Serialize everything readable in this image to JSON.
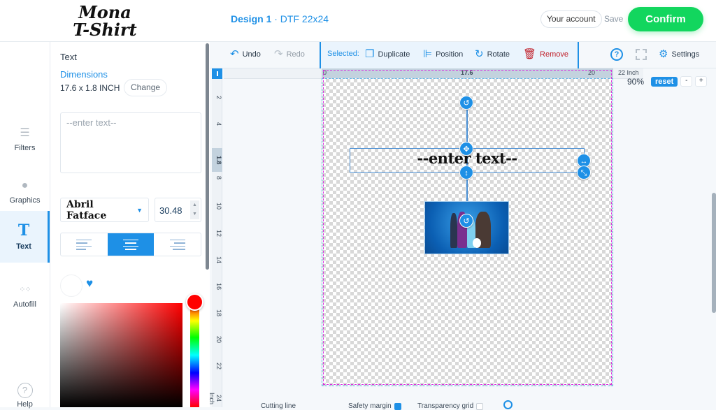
{
  "header": {
    "logo_line1": "Mona",
    "logo_line2": "T-Shirt",
    "design_name": "Design 1",
    "design_product": " · DTF 22x24",
    "account_label": "Your account",
    "save_label": "Save",
    "confirm_label": "Confirm"
  },
  "rail": {
    "items": [
      {
        "label": "Filters",
        "icon": "sliders-icon"
      },
      {
        "label": "Graphics",
        "icon": "drop-icon"
      },
      {
        "label": "Text",
        "icon": "text-icon",
        "active": true
      },
      {
        "label": "Autofill",
        "icon": "grid-dots-icon"
      }
    ],
    "help_label": "Help"
  },
  "panel": {
    "title": "Text",
    "dimensions_label": "Dimensions",
    "dimensions_value": "17.6 x 1.8 INCH",
    "change_label": "Change",
    "text_placeholder": "--enter text--",
    "font_name": "Abril Fatface",
    "font_size": "30.48",
    "alignment": "center",
    "alignment_options": [
      "left",
      "center",
      "right"
    ],
    "selected_color": "#ff0000"
  },
  "toolbar": {
    "undo": "Undo",
    "redo": "Redo",
    "selected_label": "Selected:",
    "duplicate": "Duplicate",
    "position": "Position",
    "rotate": "Rotate",
    "remove": "Remove",
    "settings": "Settings"
  },
  "ruler": {
    "top_start": "0",
    "top_selection": "17.6",
    "top_20": "20",
    "top_end": "22 Inch",
    "left_labels": [
      "2",
      "4",
      "8",
      "10",
      "12",
      "14",
      "16",
      "18",
      "20",
      "22",
      "24 Inch"
    ],
    "left_selection": "1.8"
  },
  "canvas": {
    "text": "--enter text--",
    "zoom": "90%",
    "reset_label": "reset",
    "zoom_out_label": "-",
    "zoom_in_label": "+"
  },
  "bottom": {
    "cutting_line": "Cutting line",
    "safety_margin": "Safety margin",
    "safety_margin_checked": true,
    "transparency_grid": "Transparency grid",
    "transparency_grid_checked": false
  },
  "colors": {
    "accent": "#1e90e6",
    "confirm": "#12d65e",
    "danger": "#c0202a",
    "safety_line": "#d930e0"
  }
}
